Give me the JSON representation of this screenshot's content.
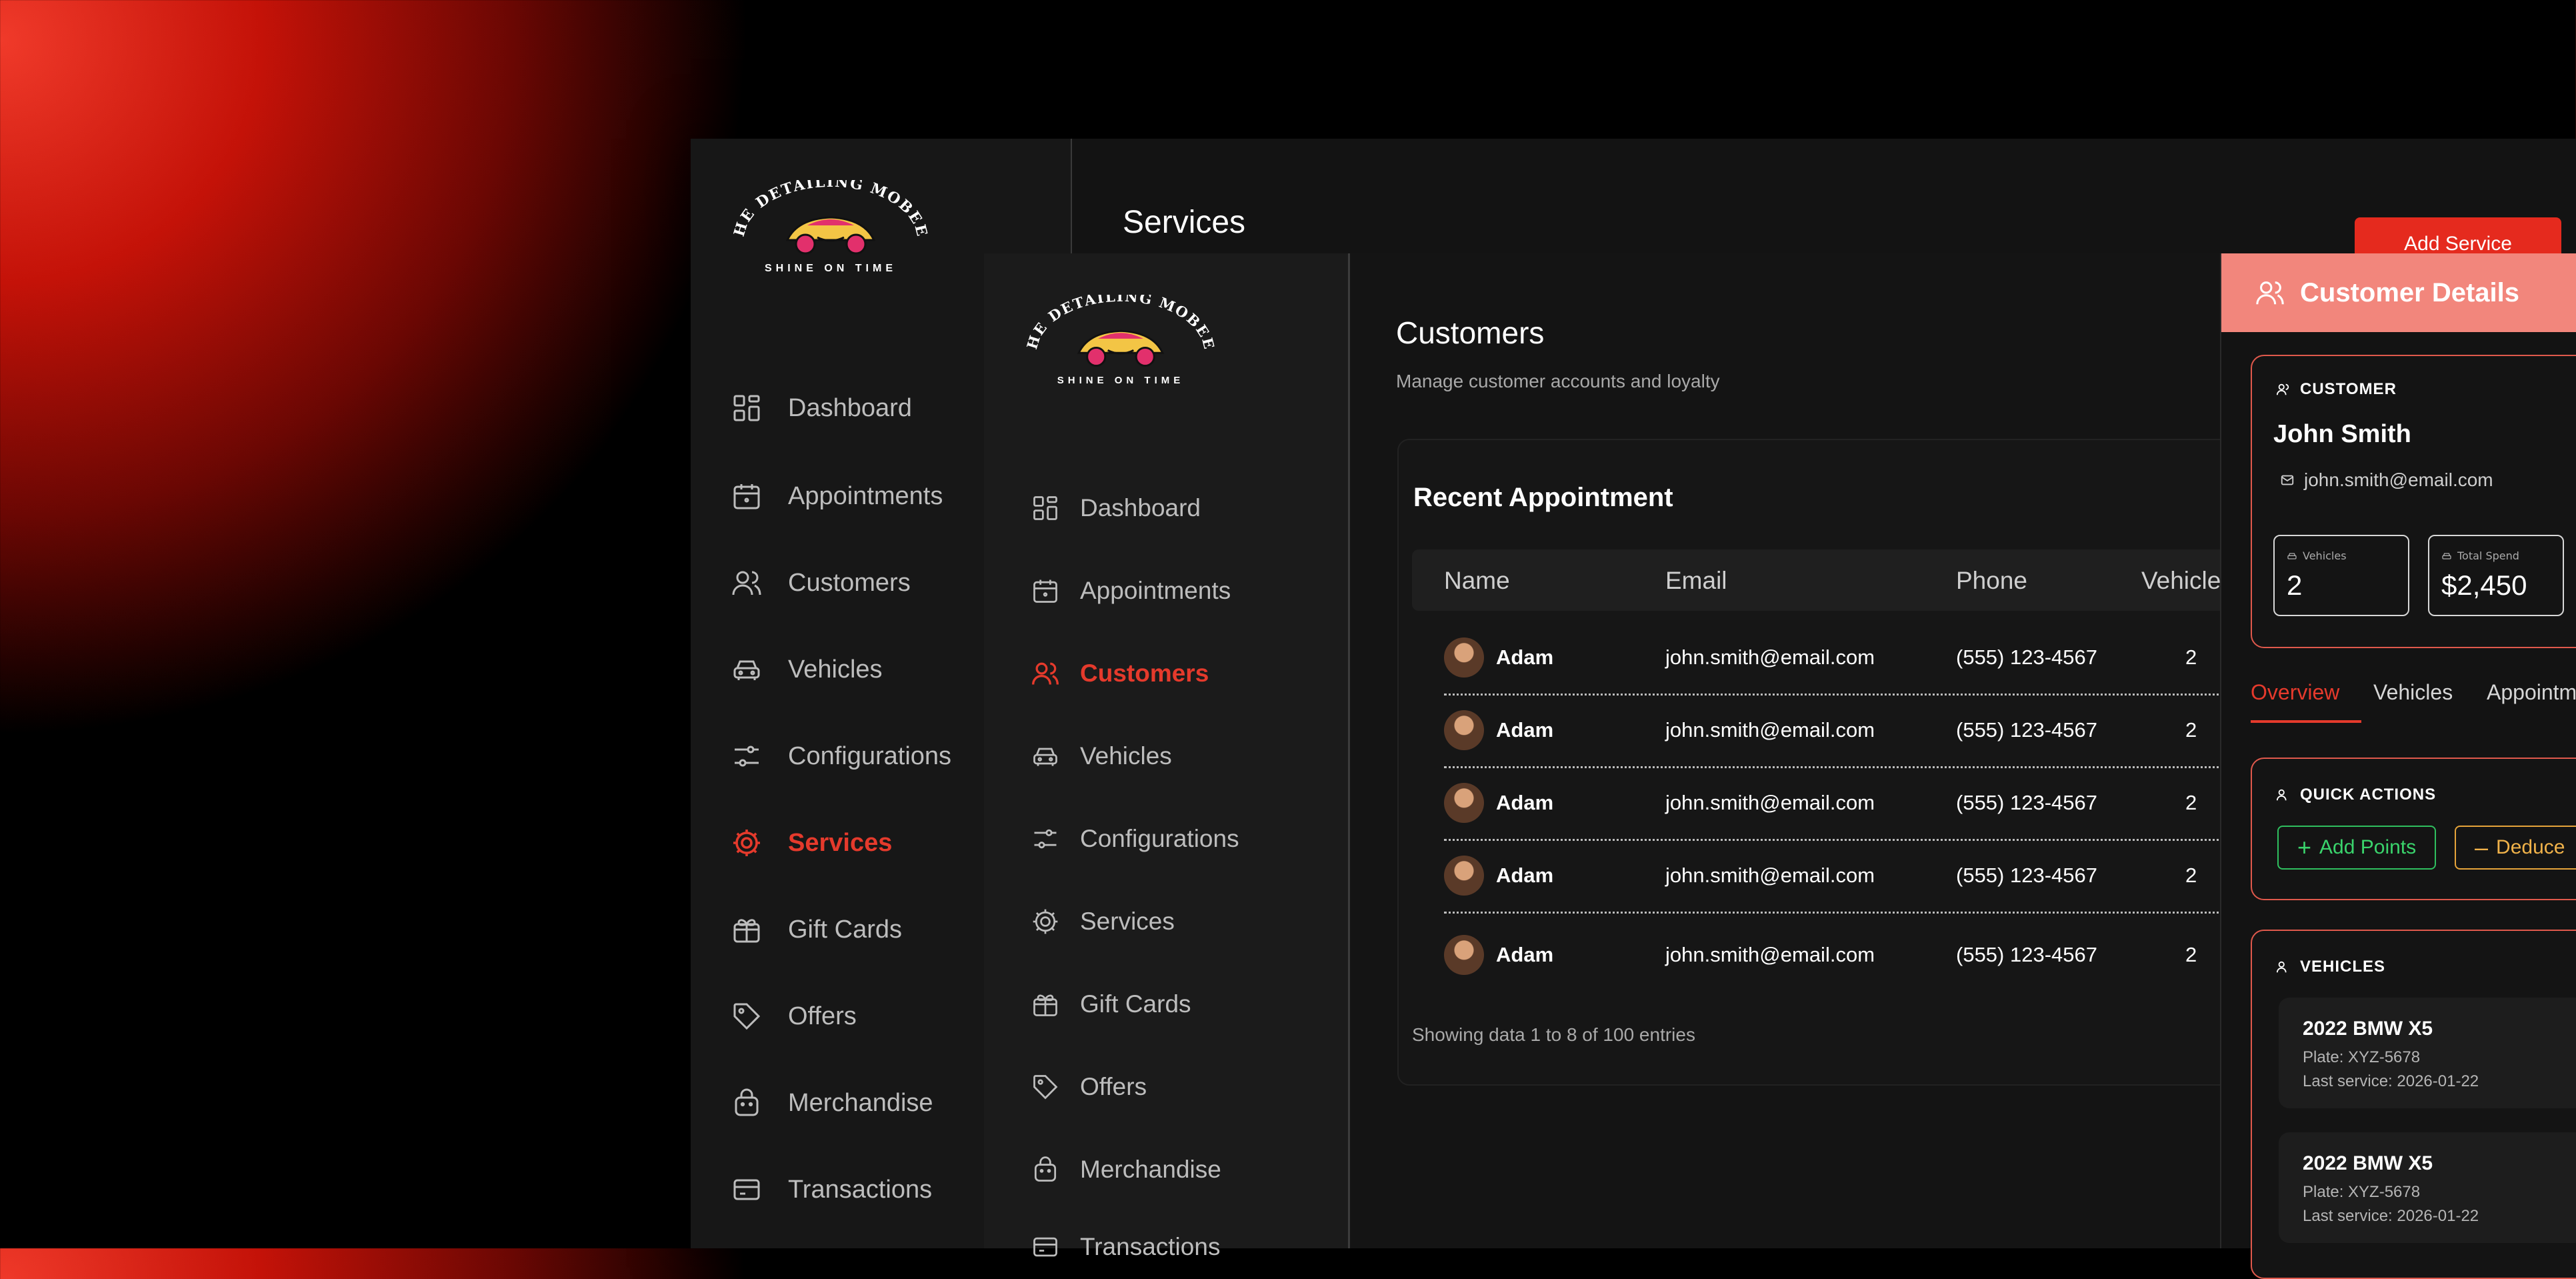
{
  "brand": {
    "logo_arc_text": "THE DETAILING MOBEEL",
    "logo_tagline": "SHINE ON TIME",
    "accent_color": "#e53a2c"
  },
  "back_window": {
    "page_title": "Services",
    "add_button_label": "Add Service",
    "nav_items": [
      {
        "label": "Dashboard",
        "icon": "grid-icon",
        "active": false
      },
      {
        "label": "Appointments",
        "icon": "calendar-icon",
        "active": false
      },
      {
        "label": "Customers",
        "icon": "users-icon",
        "active": false
      },
      {
        "label": "Vehicles",
        "icon": "car-icon",
        "active": false
      },
      {
        "label": "Configurations",
        "icon": "sliders-icon",
        "active": false
      },
      {
        "label": "Services",
        "icon": "gear-icon",
        "active": true
      },
      {
        "label": "Gift Cards",
        "icon": "gift-icon",
        "active": false
      },
      {
        "label": "Offers",
        "icon": "tag-icon",
        "active": false
      },
      {
        "label": "Merchandise",
        "icon": "bag-icon",
        "active": false
      },
      {
        "label": "Transactions",
        "icon": "card-icon",
        "active": false
      }
    ]
  },
  "front_window": {
    "page_title": "Customers",
    "page_subtitle": "Manage customer accounts and loyalty",
    "nav_items": [
      {
        "label": "Dashboard",
        "icon": "grid-icon",
        "active": false
      },
      {
        "label": "Appointments",
        "icon": "calendar-icon",
        "active": false
      },
      {
        "label": "Customers",
        "icon": "users-icon",
        "active": true
      },
      {
        "label": "Vehicles",
        "icon": "car-icon",
        "active": false
      },
      {
        "label": "Configurations",
        "icon": "sliders-icon",
        "active": false
      },
      {
        "label": "Services",
        "icon": "gear-icon",
        "active": false
      },
      {
        "label": "Gift Cards",
        "icon": "gift-icon",
        "active": false
      },
      {
        "label": "Offers",
        "icon": "tag-icon",
        "active": false
      },
      {
        "label": "Merchandise",
        "icon": "bag-icon",
        "active": false
      },
      {
        "label": "Transactions",
        "icon": "card-icon",
        "active": false
      }
    ],
    "table": {
      "title": "Recent Appointment",
      "columns": [
        "Name",
        "Email",
        "Phone",
        "Vehicles"
      ],
      "rows": [
        {
          "name": "Adam",
          "email": "john.smith@email.com",
          "phone": "(555) 123-4567",
          "vehicles": "2"
        },
        {
          "name": "Adam",
          "email": "john.smith@email.com",
          "phone": "(555) 123-4567",
          "vehicles": "2"
        },
        {
          "name": "Adam",
          "email": "john.smith@email.com",
          "phone": "(555) 123-4567",
          "vehicles": "2"
        },
        {
          "name": "Adam",
          "email": "john.smith@email.com",
          "phone": "(555) 123-4567",
          "vehicles": "2"
        },
        {
          "name": "Adam",
          "email": "john.smith@email.com",
          "phone": "(555) 123-4567",
          "vehicles": "2"
        }
      ],
      "footer": "Showing data 1 to 8 of  100 entries"
    }
  },
  "drawer": {
    "title": "Customer Details",
    "customer_section_label": "CUSTOMER",
    "customer_name": "John Smith",
    "customer_email": "john.smith@email.com",
    "stats": [
      {
        "label": "Vehicles",
        "value": "2"
      },
      {
        "label": "Total Spend",
        "value": "$2,450"
      }
    ],
    "tabs": [
      {
        "label": "Overview",
        "active": true
      },
      {
        "label": "Vehicles",
        "active": false
      },
      {
        "label": "Appointments",
        "active": false
      }
    ],
    "quick_actions_label": "QUICK ACTIONS",
    "add_points_label": "Add Points",
    "deduct_label": "Deduce",
    "vehicles_label": "VEHICLES",
    "vehicles": [
      {
        "name": "2022 BMW X5",
        "plate": "Plate: XYZ-5678",
        "last_service": "Last service: 2026-01-22"
      },
      {
        "name": "2022 BMW X5",
        "plate": "Plate: XYZ-5678",
        "last_service": "Last service: 2026-01-22"
      }
    ]
  }
}
